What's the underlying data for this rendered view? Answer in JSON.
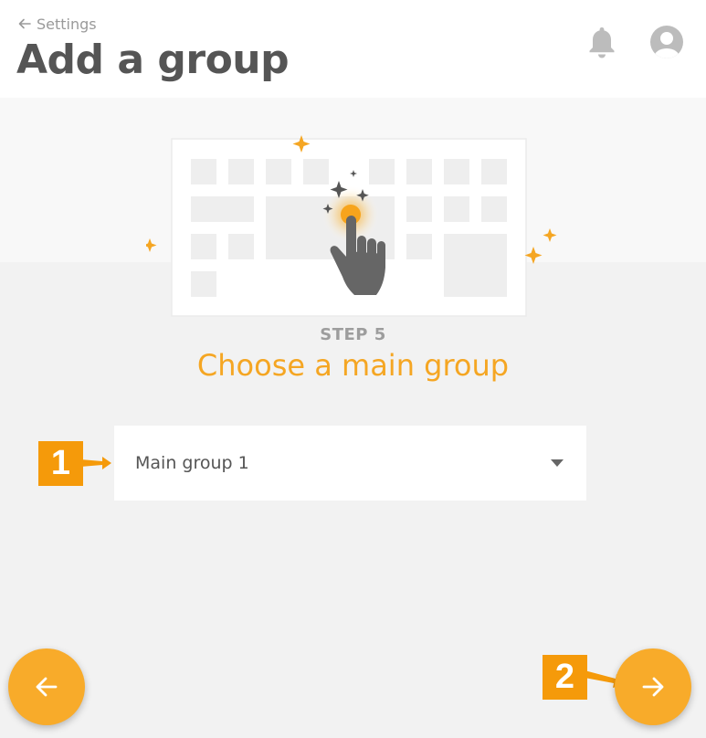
{
  "header": {
    "back_label": "Settings",
    "title": "Add a group",
    "icons": [
      "back-arrow-icon",
      "bell-icon",
      "user-avatar-icon"
    ]
  },
  "step": {
    "label": "STEP 5",
    "title": "Choose a main group"
  },
  "main_group_select": {
    "selected_value": "Main group 1"
  },
  "callouts": {
    "first": "1",
    "second": "2"
  },
  "navigation": {
    "back_icon": "arrow-left-icon",
    "next_icon": "arrow-right-icon"
  },
  "colors": {
    "accent": "#f5a623",
    "callout": "#f59a0a",
    "title_text": "#555555",
    "background": "#f2f2f2"
  }
}
